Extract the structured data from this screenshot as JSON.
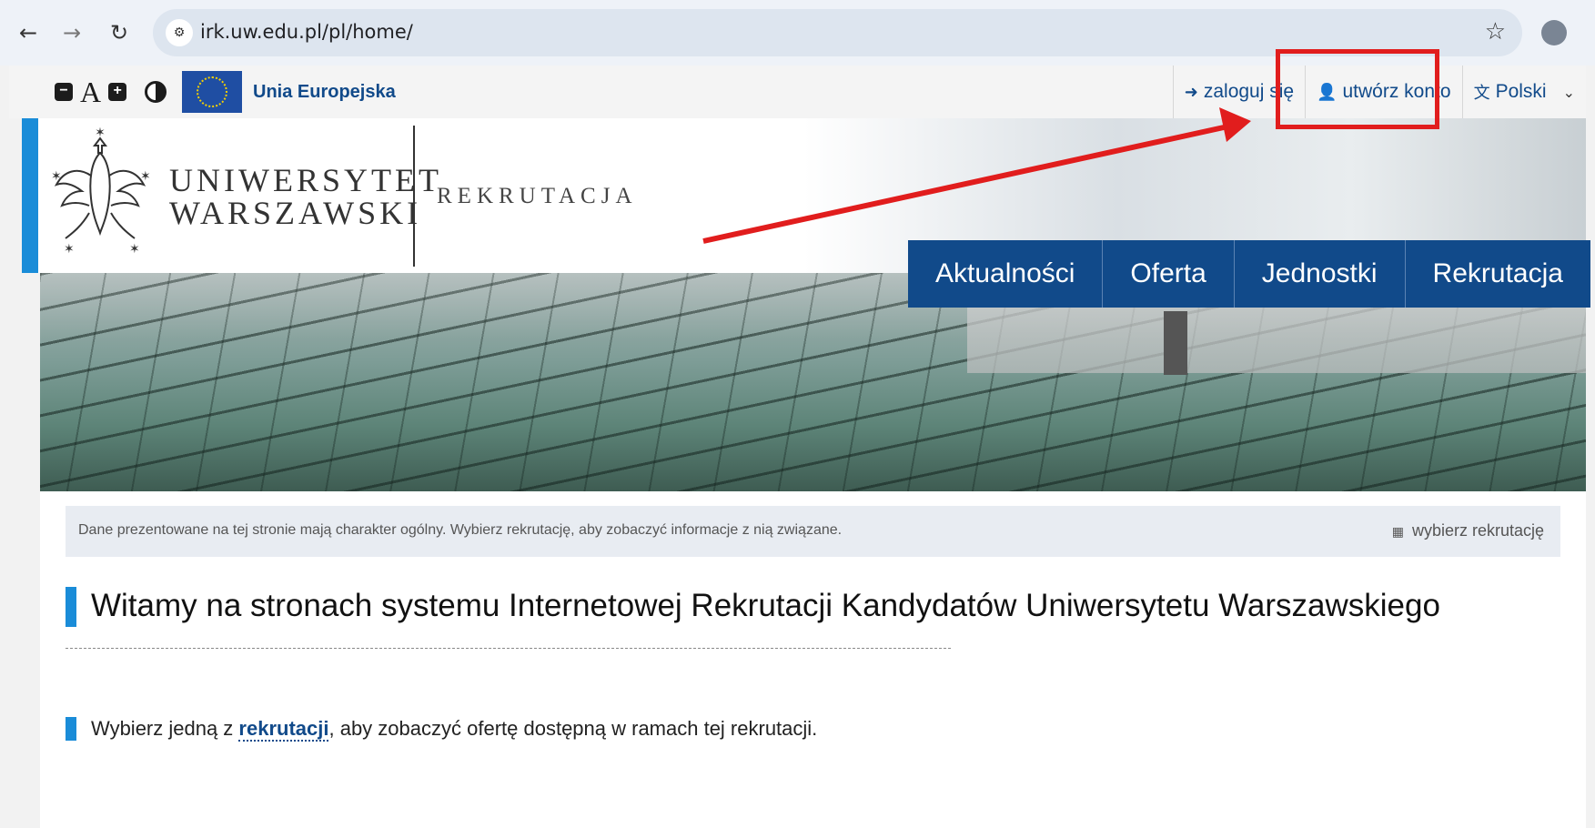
{
  "browser": {
    "url": "irk.uw.edu.pl/pl/home/",
    "back_icon": "arrow-left-icon",
    "forward_icon": "arrow-right-icon",
    "reload_icon": "reload-icon",
    "bookmark_icon": "star-icon"
  },
  "topbar": {
    "eu_label": "Unia Europejska",
    "login": "zaloguj się",
    "create_account": "utwórz konto",
    "language": "Polski"
  },
  "header": {
    "uni_line1": "UNIWERSYTET",
    "uni_line2": "WARSZAWSKI",
    "section": "REKRUTACJA"
  },
  "nav": {
    "items": [
      "Aktualności",
      "Oferta",
      "Jednostki",
      "Rekrutacja"
    ]
  },
  "content": {
    "info_text": "Dane prezentowane na tej stronie mają charakter ogólny. Wybierz rekrutację, aby zobaczyć informacje z nią związane.",
    "info_link": "wybierz rekrutację",
    "welcome": "Witamy na stronach systemu Internetowej Rekrutacji Kandydatów Uniwersytetu Warszawskiego",
    "choose_before": "Wybierz jedną z ",
    "choose_link": "rekrutacji",
    "choose_after": ", aby zobaczyć ofertę dostępną w ramach tej rekrutacji."
  },
  "colors": {
    "brand_blue": "#114a8a",
    "accent_blue": "#1a8cd8",
    "annotation_red": "#e11d1d"
  }
}
